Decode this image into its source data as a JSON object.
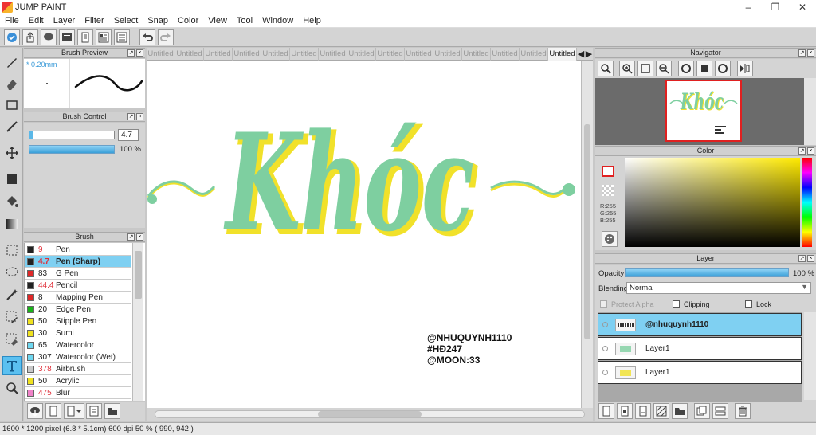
{
  "window": {
    "title": "JUMP PAINT"
  },
  "menu": [
    "File",
    "Edit",
    "Layer",
    "Filter",
    "Select",
    "Snap",
    "Color",
    "View",
    "Tool",
    "Window",
    "Help"
  ],
  "brush_preview": {
    "title": "Brush Preview",
    "size_label": "* 0.20mm"
  },
  "brush_control": {
    "title": "Brush Control",
    "size_value": "4.7",
    "opacity_value": "100 %"
  },
  "brush_panel": {
    "title": "Brush",
    "items": [
      {
        "size": "9",
        "name": "Pen",
        "color": "#222222",
        "red_size": true
      },
      {
        "size": "4.7",
        "name": "Pen (Sharp)",
        "color": "#222222",
        "red_size": true
      },
      {
        "size": "83",
        "name": "G Pen",
        "color": "#e02828",
        "red_size": false
      },
      {
        "size": "44.4",
        "name": "Pencil",
        "color": "#222222",
        "red_size": true
      },
      {
        "size": "8",
        "name": "Mapping Pen",
        "color": "#e02828",
        "red_size": false
      },
      {
        "size": "20",
        "name": "Edge Pen",
        "color": "#19b419",
        "red_size": false
      },
      {
        "size": "50",
        "name": "Stipple Pen",
        "color": "#f0e21e",
        "red_size": false
      },
      {
        "size": "30",
        "name": "Sumi",
        "color": "#f0e21e",
        "red_size": false
      },
      {
        "size": "65",
        "name": "Watercolor",
        "color": "#6ed7f0",
        "red_size": false
      },
      {
        "size": "307",
        "name": "Watercolor (Wet)",
        "color": "#6ed7f0",
        "red_size": false
      },
      {
        "size": "378",
        "name": "Airbrush",
        "color": "#c8c8c8",
        "red_size": true
      },
      {
        "size": "50",
        "name": "Acrylic",
        "color": "#f0e21e",
        "red_size": false
      },
      {
        "size": "475",
        "name": "Blur",
        "color": "#f082c8",
        "red_size": true
      }
    ]
  },
  "tabs": [
    "Untitled",
    "Untitled",
    "Untitled",
    "Untitled",
    "Untitled",
    "Untitled",
    "Untitled",
    "Untitled",
    "Untitled",
    "Untitled",
    "Untitled",
    "Untitled",
    "Untitled",
    "Untitled",
    "Untitled"
  ],
  "canvas": {
    "lettering": "Khóc",
    "credit_lines": [
      "@NHUQUYNH1110",
      "#HĐ247",
      "@MOON:33"
    ]
  },
  "navigator": {
    "title": "Navigator"
  },
  "color_panel": {
    "title": "Color",
    "r": "R:255",
    "g": "G:255",
    "b": "B:255"
  },
  "layer_panel": {
    "title": "Layer",
    "opacity_label": "Opacity",
    "opacity_value": "100 %",
    "blending_label": "Blending",
    "blending_value": "Normal",
    "protect_alpha": "Protect Alpha",
    "clipping": "Clipping",
    "lock": "Lock",
    "layers": [
      {
        "name": "@nhuquynh1110",
        "selected": true
      },
      {
        "name": "Layer1",
        "selected": false
      },
      {
        "name": "Layer1",
        "selected": false
      }
    ]
  },
  "status": {
    "text": "1600 * 1200 pixel   (6.8 * 5.1cm)   600 dpi   50 %   ( 990, 942 )"
  },
  "colors": {
    "accent": "#7fd0f2",
    "lettering_fill": "#7ecfa0",
    "lettering_shadow": "#f1e12a"
  }
}
